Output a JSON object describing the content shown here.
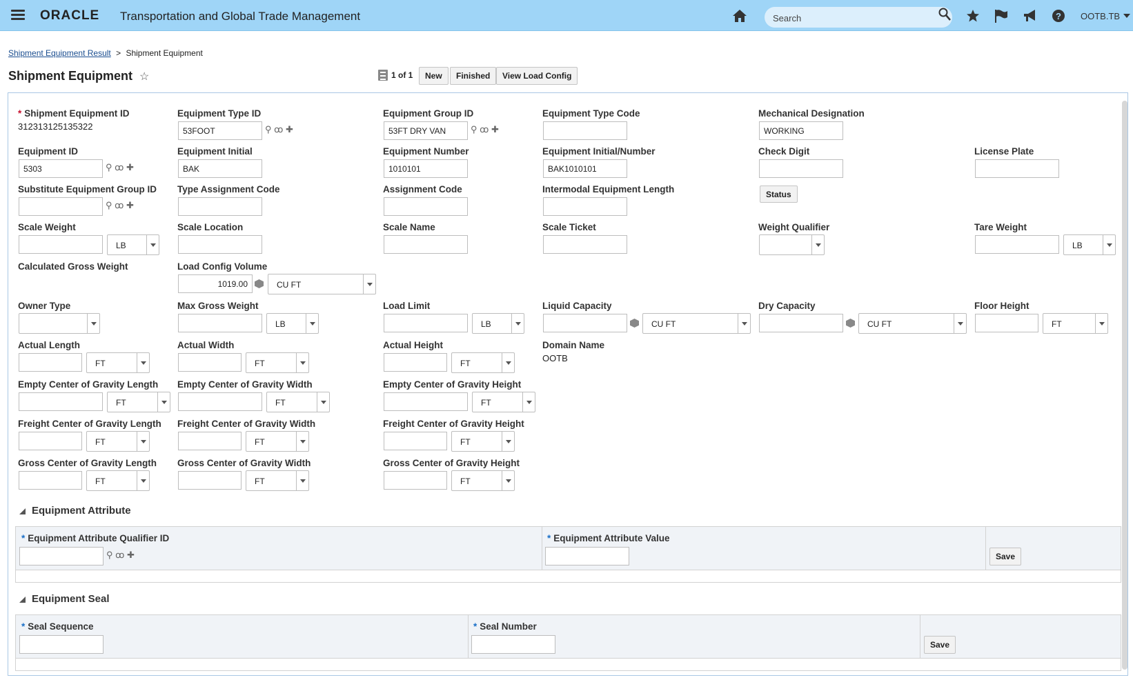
{
  "header": {
    "logo": "ORACLE",
    "app_title": "Transportation and Global Trade Management",
    "search_placeholder": "Search",
    "user": "OOTB.TB",
    "icons": [
      "menu-icon",
      "home-icon",
      "search-icon",
      "star-icon",
      "flag-icon",
      "megaphone-icon",
      "help-icon",
      "caret-down-icon"
    ]
  },
  "breadcrumb": {
    "link": "Shipment Equipment Result",
    "separator": ">",
    "current": "Shipment Equipment"
  },
  "page": {
    "title": "Shipment Equipment",
    "record_count": "1 of 1"
  },
  "toolbar": {
    "new": "New",
    "finished": "Finished",
    "view_load_config": "View Load Config"
  },
  "form": {
    "shipment_equipment_id": {
      "label": "Shipment Equipment ID",
      "value": "312313125135322",
      "required": "*"
    },
    "equipment_type_id": {
      "label": "Equipment Type ID",
      "value": "53FOOT"
    },
    "equipment_group_id": {
      "label": "Equipment Group ID",
      "value": "53FT DRY VAN"
    },
    "equipment_type_code": {
      "label": "Equipment Type Code",
      "value": ""
    },
    "mechanical_designation": {
      "label": "Mechanical Designation",
      "value": "WORKING"
    },
    "equipment_id": {
      "label": "Equipment ID",
      "value": "5303"
    },
    "equipment_initial": {
      "label": "Equipment Initial",
      "value": "BAK"
    },
    "equipment_number": {
      "label": "Equipment Number",
      "value": "1010101"
    },
    "equipment_initial_number": {
      "label": "Equipment Initial/Number",
      "value": "BAK1010101"
    },
    "check_digit": {
      "label": "Check Digit",
      "value": ""
    },
    "license_plate": {
      "label": "License Plate",
      "value": ""
    },
    "substitute_equipment_group_id": {
      "label": "Substitute Equipment Group ID",
      "value": ""
    },
    "type_assignment_code": {
      "label": "Type Assignment Code",
      "value": ""
    },
    "assignment_code": {
      "label": "Assignment Code",
      "value": ""
    },
    "intermodal_equipment_length": {
      "label": "Intermodal Equipment Length",
      "value": ""
    },
    "status_button": "Status",
    "scale_weight": {
      "label": "Scale Weight",
      "value": "",
      "unit": "LB"
    },
    "scale_location": {
      "label": "Scale Location",
      "value": ""
    },
    "scale_name": {
      "label": "Scale Name",
      "value": ""
    },
    "scale_ticket": {
      "label": "Scale Ticket",
      "value": ""
    },
    "weight_qualifier": {
      "label": "Weight Qualifier",
      "value": ""
    },
    "tare_weight": {
      "label": "Tare Weight",
      "value": "",
      "unit": "LB"
    },
    "calculated_gross_weight": {
      "label": "Calculated Gross Weight"
    },
    "load_config_volume": {
      "label": "Load Config Volume",
      "value": "1019.00",
      "unit": "CU FT"
    },
    "owner_type": {
      "label": "Owner Type",
      "value": ""
    },
    "max_gross_weight": {
      "label": "Max Gross Weight",
      "value": "",
      "unit": "LB"
    },
    "load_limit": {
      "label": "Load Limit",
      "value": "",
      "unit": "LB"
    },
    "liquid_capacity": {
      "label": "Liquid Capacity",
      "value": "",
      "unit": "CU FT"
    },
    "dry_capacity": {
      "label": "Dry Capacity",
      "value": "",
      "unit": "CU FT"
    },
    "floor_height": {
      "label": "Floor Height",
      "value": "",
      "unit": "FT"
    },
    "actual_length": {
      "label": "Actual Length",
      "value": "",
      "unit": "FT"
    },
    "actual_width": {
      "label": "Actual Width",
      "value": "",
      "unit": "FT"
    },
    "actual_height": {
      "label": "Actual Height",
      "value": "",
      "unit": "FT"
    },
    "domain_name": {
      "label": "Domain Name",
      "value": "OOTB"
    },
    "empty_cog_length": {
      "label": "Empty Center of Gravity Length",
      "value": "",
      "unit": "FT"
    },
    "empty_cog_width": {
      "label": "Empty Center of Gravity Width",
      "value": "",
      "unit": "FT"
    },
    "empty_cog_height": {
      "label": "Empty Center of Gravity Height",
      "value": "",
      "unit": "FT"
    },
    "freight_cog_length": {
      "label": "Freight Center of Gravity Length",
      "value": "",
      "unit": "FT"
    },
    "freight_cog_width": {
      "label": "Freight Center of Gravity Width",
      "value": "",
      "unit": "FT"
    },
    "freight_cog_height": {
      "label": "Freight Center of Gravity Height",
      "value": "",
      "unit": "FT"
    },
    "gross_cog_length": {
      "label": "Gross Center of Gravity Length",
      "value": "",
      "unit": "FT"
    },
    "gross_cog_width": {
      "label": "Gross Center of Gravity Width",
      "value": "",
      "unit": "FT"
    },
    "gross_cog_height": {
      "label": "Gross Center of Gravity Height",
      "value": "",
      "unit": "FT"
    }
  },
  "equipment_attribute": {
    "title": "Equipment Attribute",
    "col1": "Equipment Attribute Qualifier ID",
    "col2": "Equipment Attribute Value",
    "required": "*",
    "save": "Save"
  },
  "equipment_seal": {
    "title": "Equipment Seal",
    "col1": "Seal Sequence",
    "col2": "Seal Number",
    "required": "*",
    "save": "Save"
  },
  "glyphs": {
    "lookup": "⚲",
    "view": "ꝏ",
    "add": "✚",
    "star": "☆"
  }
}
